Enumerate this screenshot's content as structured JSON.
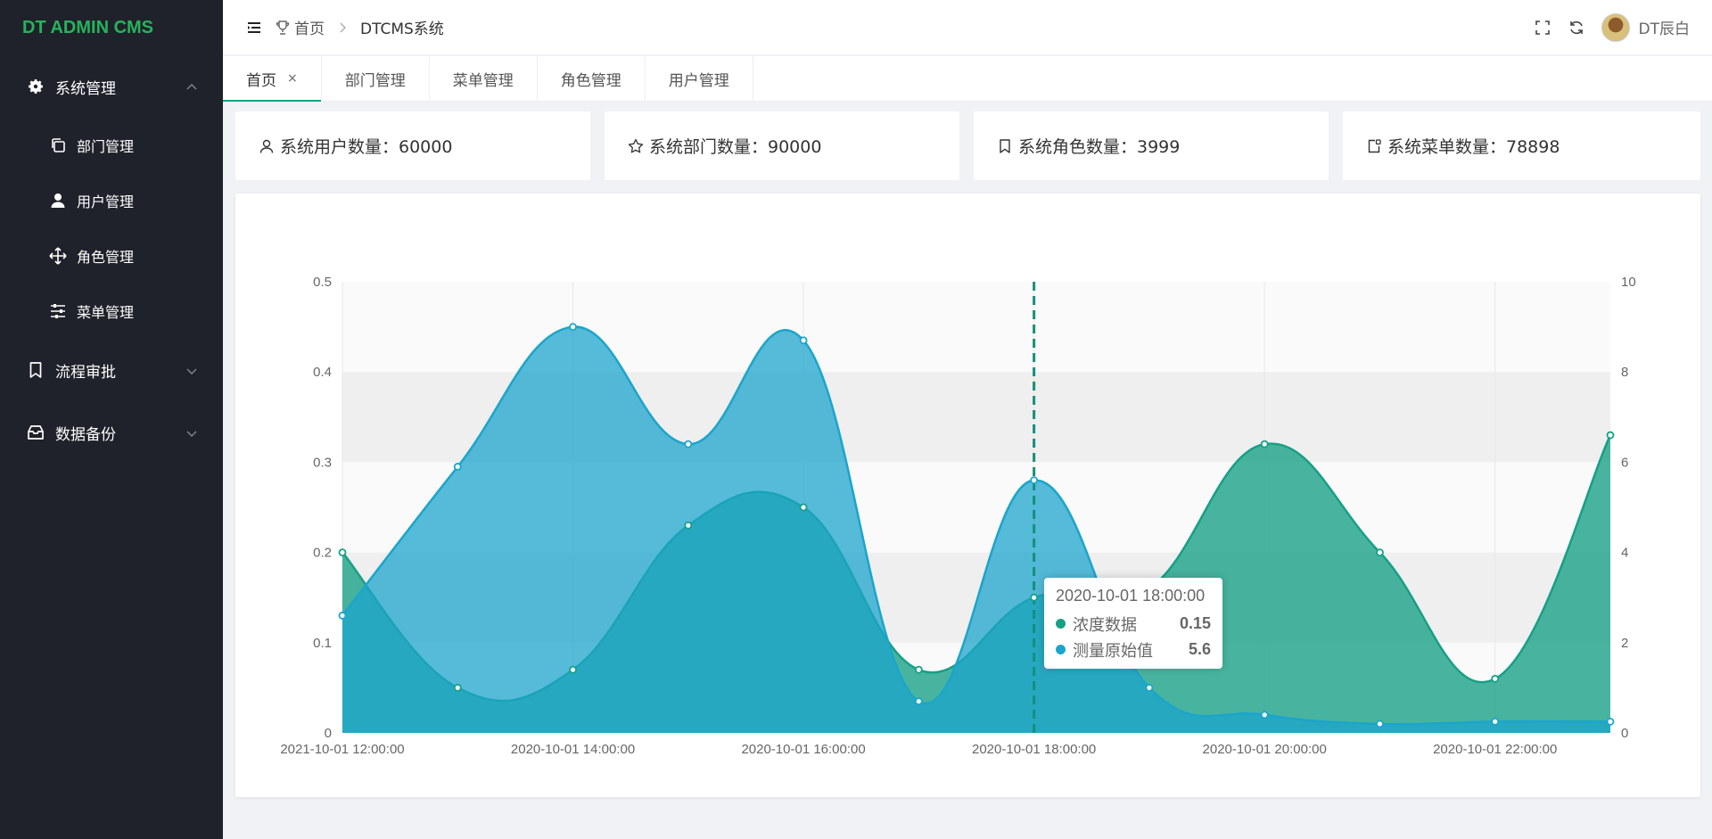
{
  "app": {
    "logo": "DT ADMIN CMS"
  },
  "sidebar": {
    "groups": [
      {
        "label": "系统管理",
        "icon": "gear-icon",
        "expanded": true,
        "items": [
          {
            "label": "部门管理",
            "icon": "copy-icon"
          },
          {
            "label": "用户管理",
            "icon": "user-icon"
          },
          {
            "label": "角色管理",
            "icon": "move-icon"
          },
          {
            "label": "菜单管理",
            "icon": "sliders-icon"
          }
        ]
      },
      {
        "label": "流程审批",
        "icon": "bookmark-icon",
        "expanded": false
      },
      {
        "label": "数据备份",
        "icon": "database-box-icon",
        "expanded": false
      }
    ]
  },
  "header": {
    "breadcrumb_home": "首页",
    "breadcrumb_current": "DTCMS系统",
    "username": "DT辰白"
  },
  "tabs": [
    {
      "label": "首页",
      "active": true,
      "close": "×"
    },
    {
      "label": "部门管理"
    },
    {
      "label": "菜单管理"
    },
    {
      "label": "角色管理"
    },
    {
      "label": "用户管理"
    }
  ],
  "stats": [
    {
      "text": "系统用户数量：60000",
      "icon": "user-outline-icon"
    },
    {
      "text": "系统部门数量：90000",
      "icon": "star-outline-icon"
    },
    {
      "text": "系统角色数量：3999",
      "icon": "bookmark-outline-icon"
    },
    {
      "text": "系统菜单数量：78898",
      "icon": "menu-box-icon"
    }
  ],
  "colors": {
    "teal": "#16a085",
    "blue": "#1ba5cc",
    "sidebar": "#1f222a",
    "logo": "#27b35b"
  },
  "chart_data": {
    "type": "area",
    "categories": [
      "2021-10-01 12:00:00",
      "",
      "2020-10-01 14:00:00",
      "",
      "2020-10-01 16:00:00",
      "",
      "2020-10-01 18:00:00",
      "",
      "2020-10-01 20:00:00",
      "",
      "2020-10-01 22:00:00",
      ""
    ],
    "y_left": {
      "ticks": [
        "0",
        "0.1",
        "0.2",
        "0.3",
        "0.4",
        "0.5"
      ],
      "range": [
        0,
        0.5
      ]
    },
    "y_right": {
      "ticks": [
        "0",
        "2",
        "4",
        "6",
        "8",
        "10"
      ],
      "range": [
        0,
        10
      ]
    },
    "series": [
      {
        "name": "浓度数据",
        "axis": "left",
        "color": "#16a085",
        "values": [
          0.2,
          0.05,
          0.07,
          0.23,
          0.25,
          0.07,
          0.15,
          0.16,
          0.32,
          0.2,
          0.06,
          0.33
        ]
      },
      {
        "name": "测量原始值",
        "axis": "right",
        "color": "#1ba5cc",
        "values": [
          2.6,
          5.9,
          9.0,
          6.4,
          8.7,
          0.7,
          5.6,
          1.0,
          0.4,
          0.2,
          0.25,
          0.25
        ]
      }
    ],
    "marked_category_index": 6,
    "tooltip": {
      "title": "2020-10-01 18:00:00",
      "rows": [
        {
          "name": "浓度数据",
          "value": "0.15"
        },
        {
          "name": "测量原始值",
          "value": "5.6"
        }
      ]
    }
  }
}
